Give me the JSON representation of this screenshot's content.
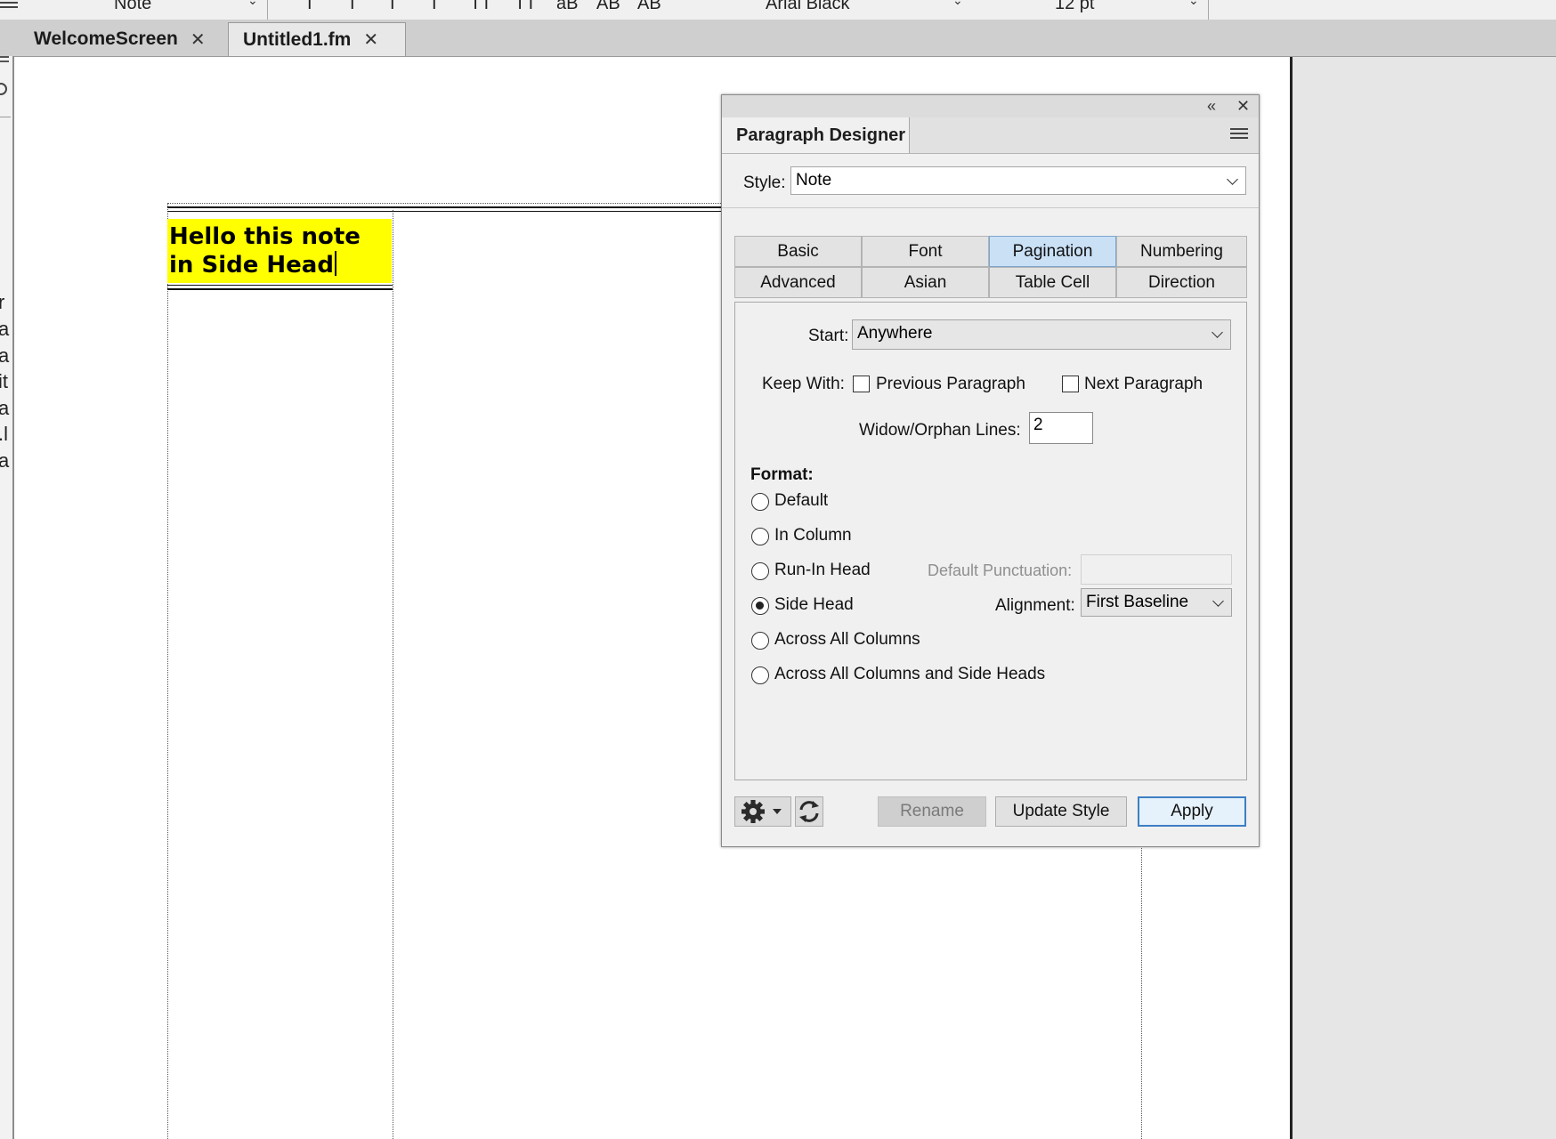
{
  "toolbar": {
    "style_value": "Note",
    "format_glyphs": [
      "I",
      "I",
      "I",
      "I",
      "TT",
      "TT",
      "aB",
      "AB",
      "AB"
    ],
    "font_value": "Arial Black",
    "size_value": "12 pt"
  },
  "doc_tabs": [
    {
      "label": "WelcomeScreen",
      "close": "✕"
    },
    {
      "label": "Untitled1.fm",
      "close": "✕"
    }
  ],
  "left_edge_chars": [
    "r",
    "a",
    "a",
    "it",
    "a",
    ".l",
    "a"
  ],
  "document": {
    "side_head_text": "Hello this note\nin Side Head"
  },
  "panel": {
    "collapse_glyph": "«",
    "close_glyph": "✕",
    "title": "Paragraph Designer",
    "style_label": "Style:",
    "style_value": "Note",
    "tabs": [
      {
        "label": "Basic",
        "active": false
      },
      {
        "label": "Font",
        "active": false
      },
      {
        "label": "Pagination",
        "active": true
      },
      {
        "label": "Numbering",
        "active": false
      },
      {
        "label": "Advanced",
        "active": false
      },
      {
        "label": "Asian",
        "active": false
      },
      {
        "label": "Table Cell",
        "active": false
      },
      {
        "label": "Direction",
        "active": false
      }
    ],
    "start_label": "Start:",
    "start_value": "Anywhere",
    "keep_with_label": "Keep With:",
    "keep_prev_label": "Previous Paragraph",
    "keep_prev_checked": false,
    "keep_next_label": "Next Paragraph",
    "keep_next_checked": false,
    "widow_label": "Widow/Orphan Lines:",
    "widow_value": "2",
    "format_label": "Format:",
    "format_options": [
      {
        "label": "Default",
        "selected": false
      },
      {
        "label": "In Column",
        "selected": false
      },
      {
        "label": "Run-In Head",
        "selected": false
      },
      {
        "label": "Side Head",
        "selected": true
      },
      {
        "label": "Across All Columns",
        "selected": false
      },
      {
        "label": "Across All Columns and Side Heads",
        "selected": false
      }
    ],
    "default_punct_label": "Default Punctuation:",
    "default_punct_value": "",
    "alignment_label": "Alignment:",
    "alignment_value": "First Baseline",
    "buttons": {
      "rename": "Rename",
      "update_style": "Update Style",
      "apply": "Apply"
    }
  }
}
